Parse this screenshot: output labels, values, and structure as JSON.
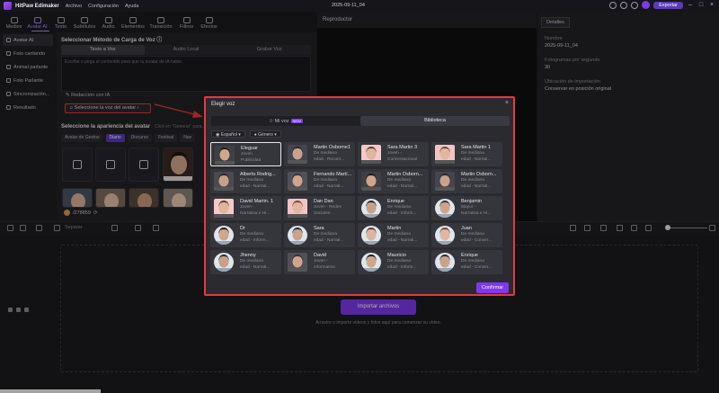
{
  "app": {
    "name": "HitPaw Edimaker",
    "menu": [
      "Archivo",
      "Configuración",
      "Ayuda"
    ],
    "doc_title": "2025-09-11_04",
    "export_label": "Exportar"
  },
  "tool_tabs": [
    "Medios",
    "Avatar AI",
    "Texto",
    "Subtítulos",
    "Audio",
    "Elementos",
    "Transición",
    "Filtros",
    "Efectos"
  ],
  "sidenav": [
    "Avatar AI",
    "Foto cantando",
    "Animal parlante",
    "Foto Parlante",
    "Sincronización...",
    "Resultado"
  ],
  "panel": {
    "method_title": "Seleccionar Método de Carga de Voz",
    "method_tabs": [
      "Texto a Voz",
      "Audio Local",
      "Grabar Voz"
    ],
    "textarea_placeholder": "Escribe o pega el contenido para que tu avatar de IA hable.",
    "ai_write_label": "Redacción con IA",
    "voice_button_label": "Seleccione la voz del avatar",
    "appearance_title": "Seleccione la apariencia del avatar",
    "appearance_hint": "Click en \"Generar\" para...",
    "filters": [
      "Avatar de Gestos",
      "Diario",
      "Discurso",
      "Festival",
      "Nav"
    ],
    "active_filter": "Diario",
    "pager_text": "/278859"
  },
  "player": {
    "title": "Reproductor"
  },
  "details": {
    "tab": "Detalles",
    "fields": [
      {
        "label": "Nombre",
        "value": "2025-09-11_04"
      },
      {
        "label": "Fotogramas por segundo",
        "value": "30"
      },
      {
        "label": "Ubicación de importación",
        "value": "Conservar en posición original"
      }
    ]
  },
  "timeline": {
    "separate_label": "Separar",
    "import_button": "Importar archivos",
    "drop_hint": "Arrastre o importe vídeos y fotos aquí para comenzar su vídeo."
  },
  "modal": {
    "title": "Elegir voz",
    "tabs": [
      "Mi voz",
      "Biblioteca"
    ],
    "new_badge": "NEW",
    "filters": [
      "Español",
      "Género"
    ],
    "confirm_label": "Confirmar",
    "voices": [
      {
        "name": "Eleguar",
        "meta": [
          "Joven",
          "Publicidad"
        ],
        "selected": true
      },
      {
        "name": "Martin Osborne1",
        "meta": [
          "De mediana",
          "edad - Recom..."
        ]
      },
      {
        "name": "Sara Martin 3",
        "meta": [
          "Joven -",
          "Conversacional"
        ]
      },
      {
        "name": "Sara Martin 1",
        "meta": [
          "De mediana",
          "edad - Narrati..."
        ]
      },
      {
        "name": "Alberto Rodrig...",
        "meta": [
          "De mediana",
          "edad - Narrati..."
        ]
      },
      {
        "name": "Fernando Martí...",
        "meta": [
          "De mediana",
          "edad - Narrati..."
        ]
      },
      {
        "name": "Martin Osborn...",
        "meta": [
          "De mediana",
          "edad - Narrati..."
        ]
      },
      {
        "name": "Martin Osborn...",
        "meta": [
          "De mediana",
          "edad - Narrati..."
        ]
      },
      {
        "name": "David Martin. 1",
        "meta": [
          "Joven -",
          "Narrativa e Hi..."
        ]
      },
      {
        "name": "Dan Dan",
        "meta": [
          "Joven - Redes",
          "Sociales"
        ]
      },
      {
        "name": "Enrique",
        "meta": [
          "De mediana",
          "edad - Inform..."
        ]
      },
      {
        "name": "Benjamin",
        "meta": [
          "Mayor -",
          "Narrativa e Hi..."
        ]
      },
      {
        "name": "Dr",
        "meta": [
          "De mediana",
          "edad - Inform..."
        ]
      },
      {
        "name": "Sara",
        "meta": [
          "De mediana",
          "edad - Narrati..."
        ]
      },
      {
        "name": "Martin",
        "meta": [
          "De mediana",
          "edad - Narrati..."
        ]
      },
      {
        "name": "Juan",
        "meta": [
          "De mediana",
          "edad - Conver..."
        ]
      },
      {
        "name": "Jhenny",
        "meta": [
          "De mediana",
          "edad - Narrati..."
        ]
      },
      {
        "name": "David",
        "meta": [
          "Joven -",
          "Informativo"
        ]
      },
      {
        "name": "Mauricio",
        "meta": [
          "De mediana",
          "edad - Inform..."
        ]
      },
      {
        "name": "Enrique",
        "meta": [
          "De mediana",
          "edad - Conver..."
        ]
      }
    ]
  },
  "colors": {
    "accent": "#7c3aed",
    "highlight": "#e23b3b"
  }
}
